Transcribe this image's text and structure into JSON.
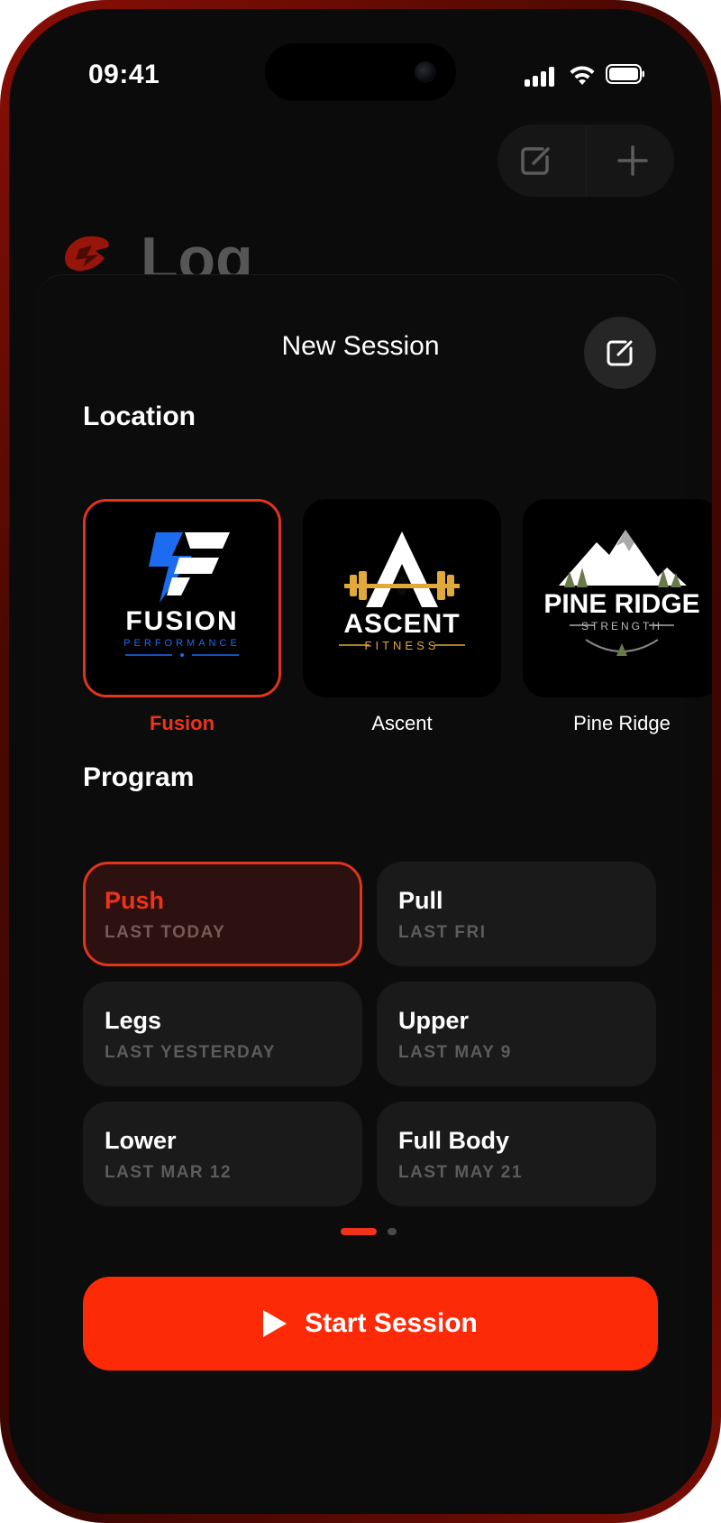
{
  "status_bar": {
    "time": "09:41"
  },
  "background": {
    "title": "Log"
  },
  "sheet": {
    "title": "New Session",
    "location_heading": "Location",
    "program_heading": "Program",
    "locations": [
      {
        "name": "Fusion",
        "logo_text": "FUSION",
        "logo_subtext": "PERFORMANCE",
        "selected": true
      },
      {
        "name": "Ascent",
        "logo_text": "ASCENT",
        "logo_subtext": "FITNESS",
        "selected": false
      },
      {
        "name": "Pine Ridge",
        "logo_text": "PINE RIDGE",
        "logo_subtext": "STRENGTH",
        "selected": false
      }
    ],
    "programs": [
      {
        "name": "Push",
        "last": "LAST TODAY",
        "selected": true
      },
      {
        "name": "Pull",
        "last": "LAST FRI",
        "selected": false
      },
      {
        "name": "Legs",
        "last": "LAST YESTERDAY",
        "selected": false
      },
      {
        "name": "Upper",
        "last": "LAST MAY 9",
        "selected": false
      },
      {
        "name": "Lower",
        "last": "LAST MAR 12",
        "selected": false
      },
      {
        "name": "Full Body",
        "last": "LAST MAY 21",
        "selected": false
      }
    ],
    "page_indicator": {
      "current": 1,
      "total": 2
    },
    "start_button": "Start Session"
  },
  "colors": {
    "accent": "#fd2a08",
    "selected_border": "#e0341c",
    "background": "#0b0b0b",
    "card": "#1a1a1a"
  },
  "icons": [
    "edit-icon",
    "plus-icon",
    "play-icon",
    "signal-icon",
    "wifi-icon",
    "battery-icon"
  ]
}
